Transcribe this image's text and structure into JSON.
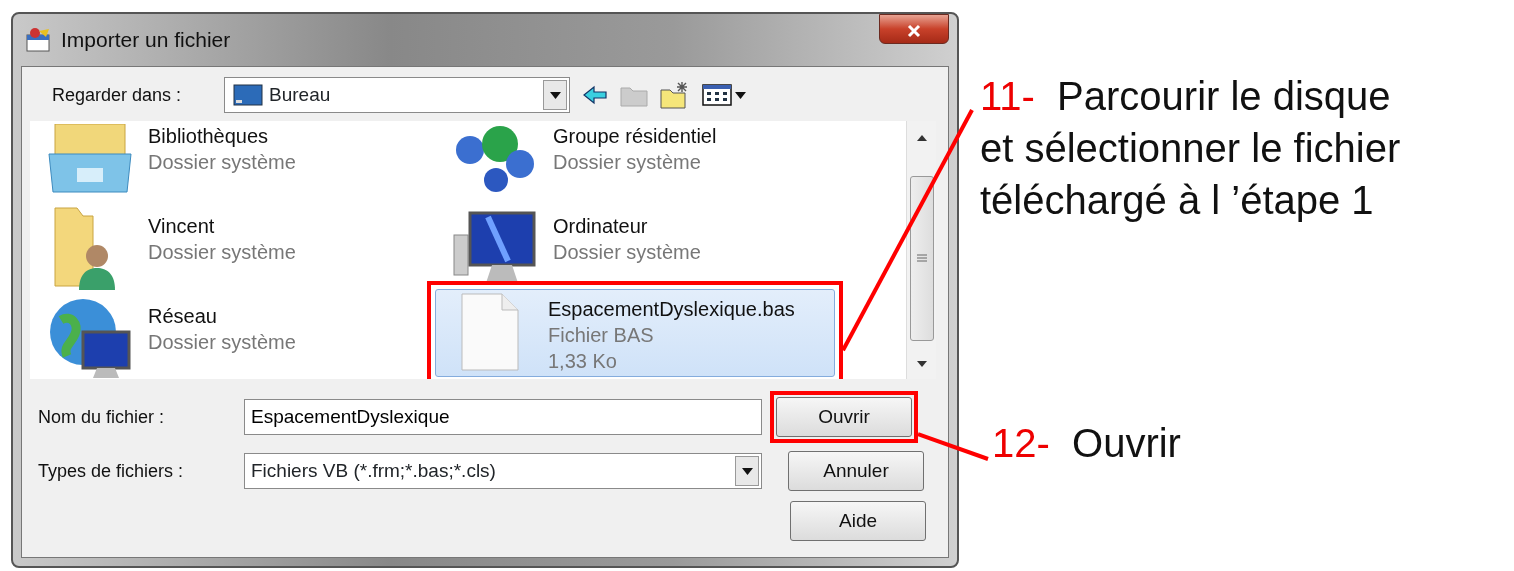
{
  "window": {
    "title": "Importer un fichier"
  },
  "look_in": {
    "label": "Regarder dans :",
    "value": "Bureau"
  },
  "files": [
    {
      "name": "Bibliothèques",
      "type": "Dossier système",
      "kind": "library",
      "selected": false,
      "annotated": false
    },
    {
      "name": "Groupe résidentiel",
      "type": "Dossier système",
      "kind": "homegroup",
      "selected": false,
      "annotated": false
    },
    {
      "name": "Vincent",
      "type": "Dossier système",
      "kind": "user",
      "selected": false,
      "annotated": false
    },
    {
      "name": "Ordinateur",
      "type": "Dossier système",
      "kind": "computer",
      "selected": false,
      "annotated": false
    },
    {
      "name": "Réseau",
      "type": "Dossier système",
      "kind": "network",
      "selected": false,
      "annotated": false
    },
    {
      "name": "EspacementDyslexique.bas",
      "type": "Fichier BAS",
      "size": "1,33 Ko",
      "kind": "file",
      "selected": true,
      "annotated": true
    }
  ],
  "file_name": {
    "label": "Nom du fichier :",
    "value": "EspacementDyslexique"
  },
  "file_types": {
    "label": "Types de fichiers :",
    "value": "Fichiers VB (*.frm;*.bas;*.cls)"
  },
  "buttons": [
    {
      "label": "Ouvrir",
      "annotated": true
    },
    {
      "label": "Annuler",
      "annotated": false
    },
    {
      "label": "Aide",
      "annotated": false
    }
  ],
  "annotations": [
    {
      "number": "11-",
      "lines": [
        "Parcourir le disque",
        "et sélectionner le fichier",
        "téléchargé à l ’étape 1"
      ]
    },
    {
      "number": "12-",
      "lines": [
        "Ouvrir"
      ]
    }
  ]
}
